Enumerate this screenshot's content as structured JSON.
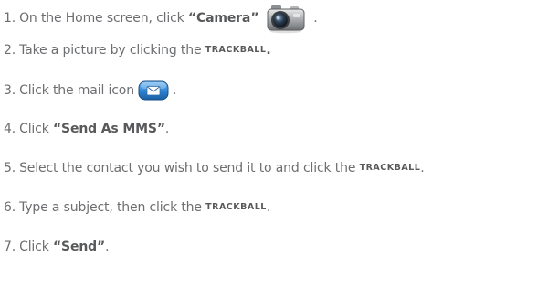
{
  "steps": [
    {
      "num": "1.",
      "pre": "On the Home screen, click ",
      "bold": "“Camera”",
      "post": ".",
      "icon": "camera-icon"
    },
    {
      "num": "2.",
      "pre": "Take a picture by clicking the ",
      "smallcaps": "TRACKBALL",
      "post": "."
    },
    {
      "num": "3.",
      "pre": "Click the mail icon",
      "post": ".",
      "icon": "mail-icon"
    },
    {
      "num": "4.",
      "pre": "Click ",
      "bold": "“Send As MMS”",
      "post": "."
    },
    {
      "num": "5.",
      "pre": "Select the contact you wish to send it to and click the ",
      "smallcaps": "TRACKBALL",
      "post": "."
    },
    {
      "num": "6.",
      "pre": "Type a subject, then click the ",
      "smallcaps": "TRACKBALL",
      "post": "."
    },
    {
      "num": "7.",
      "pre": "Click ",
      "bold": "“Send”",
      "post": "."
    }
  ],
  "colors": {
    "text": "#6d6e71",
    "mail_icon_blue": "#2f86d6"
  }
}
